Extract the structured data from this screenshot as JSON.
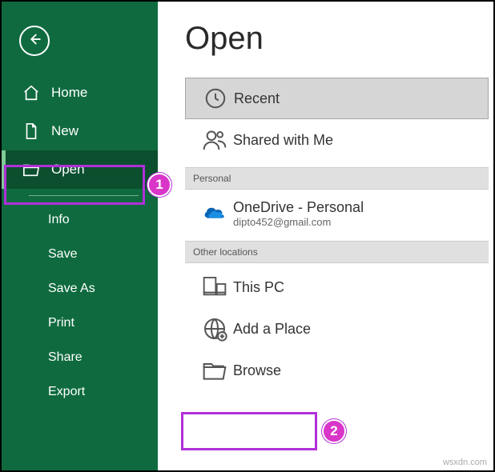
{
  "sidebar": {
    "items": [
      {
        "label": "Home"
      },
      {
        "label": "New"
      },
      {
        "label": "Open"
      }
    ],
    "subitems": [
      {
        "label": "Info"
      },
      {
        "label": "Save"
      },
      {
        "label": "Save As"
      },
      {
        "label": "Print"
      },
      {
        "label": "Share"
      },
      {
        "label": "Export"
      }
    ]
  },
  "main": {
    "title": "Open",
    "sections": {
      "top": [
        {
          "label": "Recent"
        },
        {
          "label": "Shared with Me"
        }
      ],
      "personal_header": "Personal",
      "personal": [
        {
          "label": "OneDrive - Personal",
          "sub": "dipto452@gmail.com"
        }
      ],
      "other_header": "Other locations",
      "other": [
        {
          "label": "This PC"
        },
        {
          "label": "Add a Place"
        },
        {
          "label": "Browse"
        }
      ]
    }
  },
  "callouts": {
    "one": "1",
    "two": "2"
  },
  "watermark": "wsxdn.com"
}
